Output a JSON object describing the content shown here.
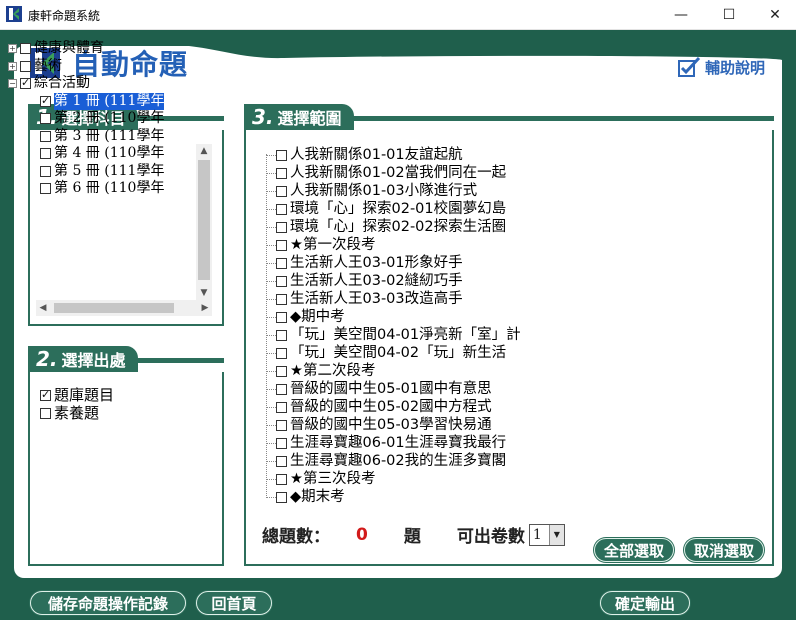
{
  "window": {
    "title": "康軒命題系統",
    "min_glyph": "—",
    "max_glyph": "☐",
    "close_glyph": "✕"
  },
  "header": {
    "title": "自動命題",
    "help_label": "輔助說明"
  },
  "panel1": {
    "number": "1.",
    "title": "選擇科目",
    "items": [
      {
        "label": "健康與體育",
        "expander": "+",
        "checked": false,
        "level": 0
      },
      {
        "label": "藝術",
        "expander": "+",
        "checked": false,
        "level": 0
      },
      {
        "label": "綜合活動",
        "expander": "−",
        "checked": true,
        "level": 0
      },
      {
        "label": "第 1 冊 (111學年",
        "checked": true,
        "level": 1,
        "selected": true
      },
      {
        "label": "第 2 冊 (110學年",
        "checked": false,
        "level": 1
      },
      {
        "label": "第 3 冊 (111學年",
        "checked": false,
        "level": 1
      },
      {
        "label": "第 4 冊 (110學年",
        "checked": false,
        "level": 1
      },
      {
        "label": "第 5 冊 (111學年",
        "checked": false,
        "level": 1
      },
      {
        "label": "第 6 冊 (110學年",
        "checked": false,
        "level": 1
      }
    ]
  },
  "panel2": {
    "number": "2.",
    "title": "選擇出處",
    "options": [
      {
        "label": "題庫題目",
        "checked": true
      },
      {
        "label": "素養題",
        "checked": false
      }
    ]
  },
  "panel3": {
    "number": "3.",
    "title": "選擇範圍",
    "items": [
      "人我新關係01-01友誼起航",
      "人我新關係01-02當我們同在一起",
      "人我新關係01-03小隊進行式",
      "環境「心」探索02-01校園夢幻島",
      "環境「心」探索02-02探索生活圈",
      "★第一次段考",
      "生活新人王03-01形象好手",
      "生活新人王03-02縫紉巧手",
      "生活新人王03-03改造高手",
      "◆期中考",
      "「玩」美空間04-01淨亮新「室」計",
      "「玩」美空間04-02「玩」新生活",
      "★第二次段考",
      "晉級的國中生05-01國中有意思",
      "晉級的國中生05-02國中方程式",
      "晉級的國中生05-03學習快易通",
      "生涯尋寶趣06-01生涯尋寶我最行",
      "生涯尋寶趣06-02我的生涯多寶閣",
      "★第三次段考",
      "◆期末考"
    ]
  },
  "totals": {
    "total_label": "總題數：",
    "total_count": "0",
    "unit": "題",
    "tests_label": "可出卷數",
    "tests_value": "1"
  },
  "buttons": {
    "select_all": "全部選取",
    "deselect_all": "取消選取",
    "save_log": "儲存命題操作記錄",
    "home": "回首頁",
    "confirm": "確定輸出"
  },
  "colors": {
    "frame_green": "#1f5f4c",
    "panel_green": "#2c6e5b",
    "title_blue": "#2460b6",
    "selection_blue": "#1a5ed6",
    "count_red": "#d21a1a"
  }
}
